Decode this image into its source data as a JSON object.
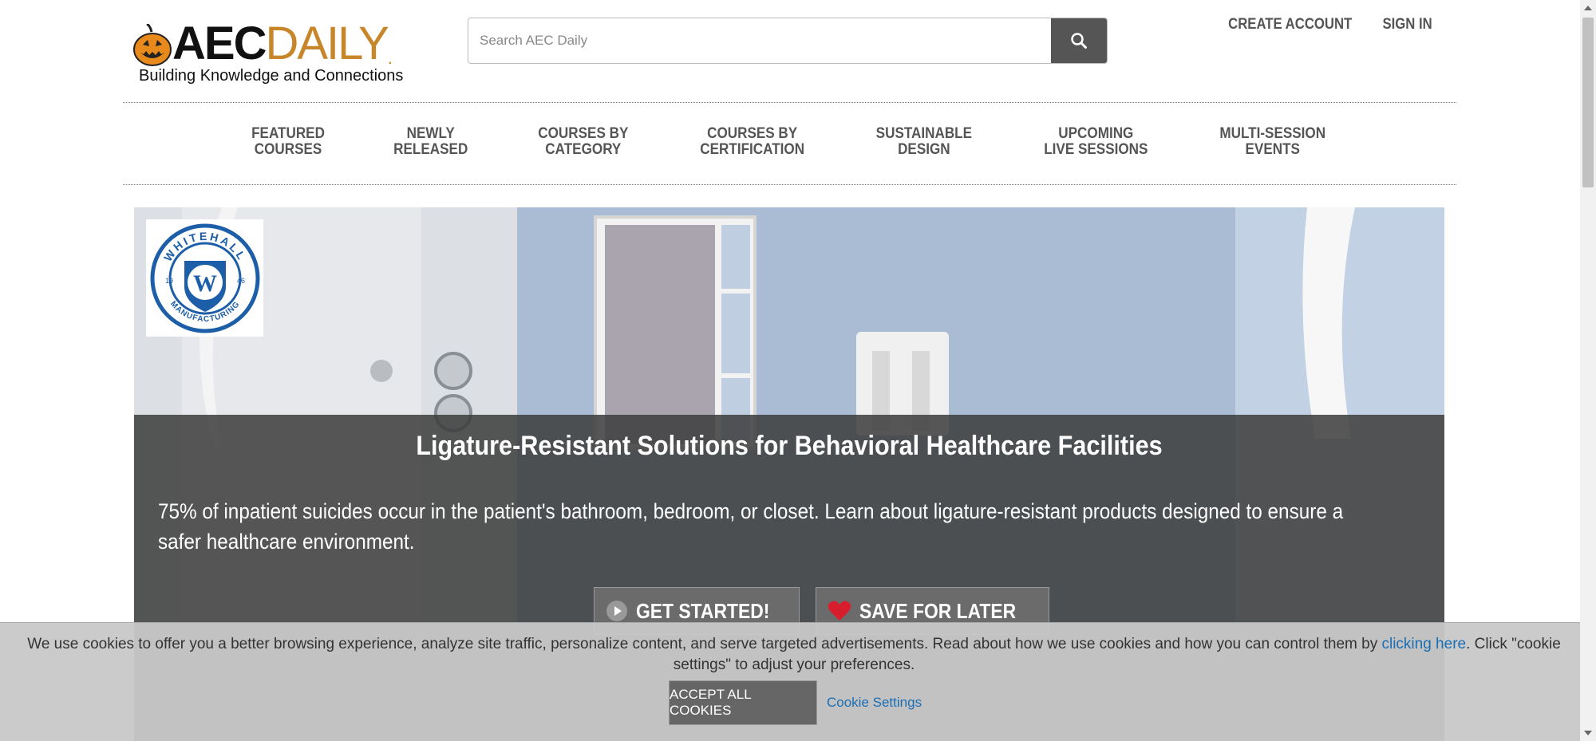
{
  "header": {
    "logo_main": "AEC",
    "logo_accent": "DAILY",
    "logo_dot": ".",
    "tagline": "Building Knowledge and Connections",
    "search_placeholder": "Search AEC Daily",
    "search_icon": "search-icon",
    "create_account": "CREATE ACCOUNT",
    "sign_in": "SIGN IN"
  },
  "nav": {
    "items": [
      {
        "line1": "FEATURED",
        "line2": "COURSES"
      },
      {
        "line1": "NEWLY",
        "line2": "RELEASED"
      },
      {
        "line1": "COURSES BY",
        "line2": "CATEGORY"
      },
      {
        "line1": "COURSES BY",
        "line2": "CERTIFICATION"
      },
      {
        "line1": "SUSTAINABLE",
        "line2": "DESIGN"
      },
      {
        "line1": "UPCOMING",
        "line2": "LIVE SESSIONS"
      },
      {
        "line1": "MULTI-SESSION",
        "line2": "EVENTS"
      }
    ]
  },
  "hero": {
    "brand_text_top": "WHITEHALL",
    "brand_text_bottom": "MANUFACTURING",
    "brand_year_left": "19",
    "brand_year_right": "46",
    "brand_letter": "W",
    "title": "Ligature-Resistant Solutions for Behavioral Healthcare Facilities",
    "description": "75% of inpatient suicides occur in the patient's bathroom, bedroom, or closet. Learn about ligature-resistant products designed to ensure a safer healthcare environment.",
    "get_started": "GET STARTED!",
    "save_later": "SAVE FOR LATER",
    "play_icon": "play-icon",
    "heart_icon": "heart-icon"
  },
  "cookie": {
    "text_before": " We use cookies to offer you a better browsing experience, analyze site traffic, personalize content, and serve targeted advertisements. Read about how we use cookies and how you can control them by ",
    "link": "clicking here",
    "text_after": ". Click \"cookie settings\" to adjust your preferences.",
    "accept": "ACCEPT ALL COOKIES",
    "settings": "Cookie Settings"
  },
  "colors": {
    "brand_orange": "#c8862a",
    "link_blue": "#1a6eb3",
    "heart_red": "#d81e2c"
  }
}
